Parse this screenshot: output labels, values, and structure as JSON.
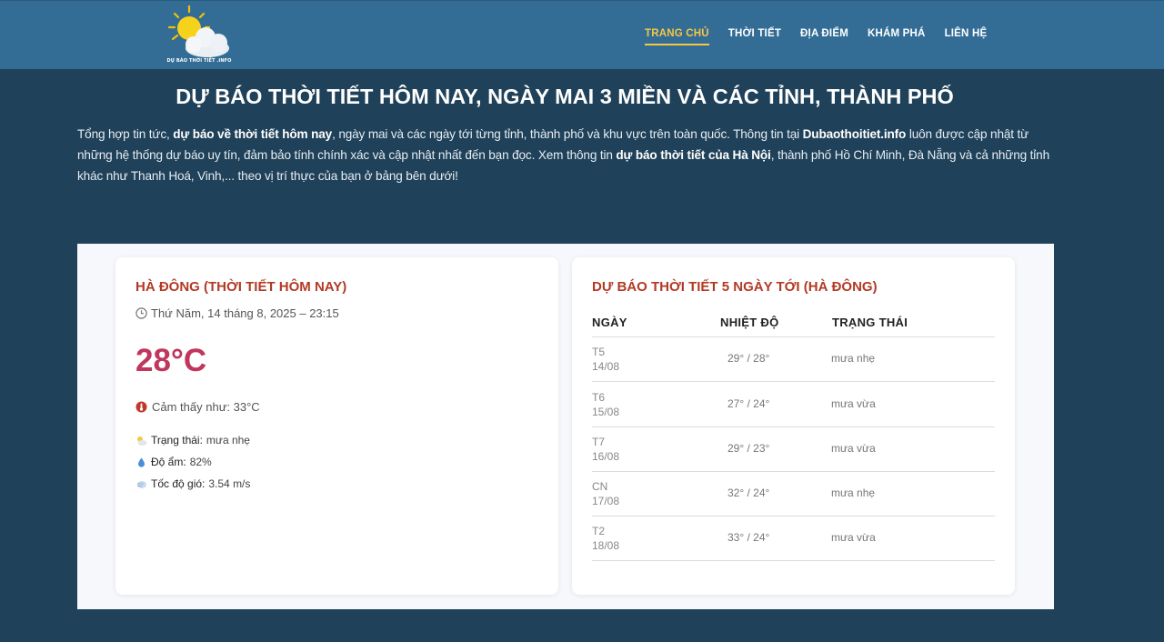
{
  "header": {
    "logo_text": "DỰ BÁO THỜI TIẾT .INFO",
    "nav": [
      {
        "label": "TRANG CHỦ",
        "active": true
      },
      {
        "label": "THỜI TIẾT",
        "active": false
      },
      {
        "label": "ĐỊA ĐIỂM",
        "active": false
      },
      {
        "label": "KHÁM PHÁ",
        "active": false
      },
      {
        "label": "LIÊN HỆ",
        "active": false
      }
    ]
  },
  "hero": {
    "title": "DỰ BÁO THỜI TIẾT HÔM NAY, NGÀY MAI 3 MIỀN VÀ CÁC TỈNH, THÀNH PHỐ",
    "intro_parts": [
      {
        "text": "Tổng hợp tin tức, ",
        "bold": false
      },
      {
        "text": "dự báo về thời tiết hôm nay",
        "bold": true
      },
      {
        "text": ", ngày mai và các ngày tới từng tỉnh, thành phố và khu vực trên toàn quốc. Thông tin tại ",
        "bold": false
      },
      {
        "text": "Dubaothoitiet.info",
        "bold": true
      },
      {
        "text": " luôn được cập nhật từ những hệ thống dự báo uy tín, đảm bảo tính chính xác và cập nhật nhất đến bạn đọc. Xem thông tin ",
        "bold": false
      },
      {
        "text": "dự báo thời tiết của Hà Nội",
        "bold": true
      },
      {
        "text": ", thành phố Hồ Chí Minh, Đà Nẵng và cả những tỉnh khác như Thanh Hoá, Vinh,... theo vị trí thực của bạn ở bảng bên dưới!",
        "bold": false
      }
    ]
  },
  "today": {
    "title": "HÀ ĐÔNG (THỜI TIẾT HÔM NAY)",
    "datetime": "Thứ Năm, 14 tháng 8, 2025 – 23:15",
    "temperature": "28°C",
    "feels_like": "Cảm thấy như: 33°C",
    "status_label": "Trạng thái:",
    "status_value": "mưa nhẹ",
    "humidity_label": "Độ ẩm:",
    "humidity_value": "82%",
    "wind_label": "Tốc độ gió:",
    "wind_value": "3.54 m/s"
  },
  "forecast": {
    "title": "DỰ BÁO THỜI TIẾT 5 NGÀY TỚI (HÀ ĐÔNG)",
    "headers": {
      "day": "NGÀY",
      "temp": "NHIỆT ĐỘ",
      "status": "TRẠNG THÁI"
    },
    "rows": [
      {
        "day": "T5",
        "date": "14/08",
        "temp": "29° / 28°",
        "status": "mưa nhẹ"
      },
      {
        "day": "T6",
        "date": "15/08",
        "temp": "27° / 24°",
        "status": "mưa vừa"
      },
      {
        "day": "T7",
        "date": "16/08",
        "temp": "29° / 23°",
        "status": "mưa vừa"
      },
      {
        "day": "CN",
        "date": "17/08",
        "temp": "32° / 24°",
        "status": "mưa nhẹ"
      },
      {
        "day": "T2",
        "date": "18/08",
        "temp": "33° / 24°",
        "status": "mưa vừa"
      }
    ]
  },
  "colors": {
    "header_bg": "#336d96",
    "page_bg": "#1f4159",
    "nav_active": "#f5c842",
    "card_title": "#b23a24",
    "temperature": "#c0365c"
  }
}
